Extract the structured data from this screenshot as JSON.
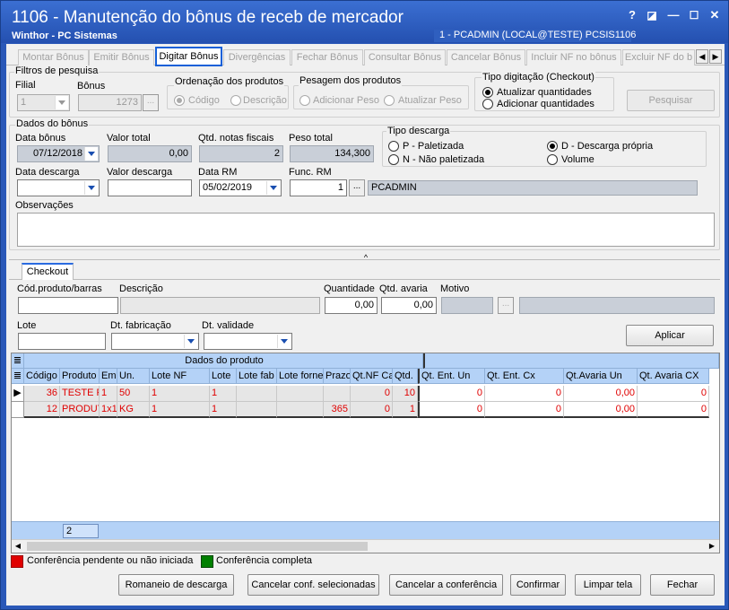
{
  "window": {
    "title": "1106 - Manutenção do bônus de receb de mercador",
    "subtitle": "Winthor - PC Sistemas",
    "user_info": "1 - PCADMIN (LOCAL@TESTE)   PCSIS1106",
    "controls": {
      "help": "?",
      "restore": "◪",
      "minimize": "—",
      "maximize": "☐",
      "close": "✕"
    }
  },
  "tabs": [
    {
      "label": "Montar Bônus",
      "active": false
    },
    {
      "label": "Emitir Bônus",
      "active": false
    },
    {
      "label": "Digitar Bônus",
      "active": true
    },
    {
      "label": "Divergências",
      "active": false
    },
    {
      "label": "Fechar Bônus",
      "active": false
    },
    {
      "label": "Consultar Bônus",
      "active": false
    },
    {
      "label": "Cancelar Bônus",
      "active": false
    },
    {
      "label": "Incluir NF no bônus",
      "active": false
    },
    {
      "label": "Excluir NF do b",
      "active": false
    }
  ],
  "tab_scroll": {
    "left": "◀",
    "right": "▶"
  },
  "filtros": {
    "legend": "Filtros de pesquisa",
    "filial_label": "Filial",
    "filial_value": "1",
    "bonus_label": "Bônus",
    "bonus_value": "1273",
    "ordenacao": {
      "legend": "Ordenação dos produtos",
      "options": [
        "Código",
        "Descrição"
      ],
      "selected": "Código"
    },
    "pesagem": {
      "legend": "Pesagem dos produtos",
      "options": [
        "Adicionar Peso",
        "Atualizar Peso"
      ]
    },
    "tipo_digitacao": {
      "legend": "Tipo digitação (Checkout)",
      "options": [
        "Atualizar quantidades",
        "Adicionar quantidades"
      ],
      "selected": "Atualizar quantidades"
    },
    "pesquisar_button": "Pesquisar"
  },
  "dados_bonus": {
    "legend": "Dados do bônus",
    "data_bonus_label": "Data bônus",
    "data_bonus_value": "07/12/2018",
    "valor_total_label": "Valor total",
    "valor_total_value": "0,00",
    "qtd_notas_label": "Qtd. notas fiscais",
    "qtd_notas_value": "2",
    "peso_total_label": "Peso total",
    "peso_total_value": "134,300",
    "tipo_descarga": {
      "legend": "Tipo descarga",
      "options": [
        "P - Paletizada",
        "N - Não paletizada",
        "D - Descarga própria",
        "Volume"
      ],
      "selected": "D - Descarga própria"
    },
    "data_descarga_label": "Data descarga",
    "data_descarga_value": "",
    "valor_descarga_label": "Valor descarga",
    "valor_descarga_value": "",
    "data_rm_label": "Data RM",
    "data_rm_value": "05/02/2019",
    "func_rm_label": "Func. RM",
    "func_rm_value": "1",
    "func_rm_name": "PCADMIN",
    "observacoes_label": "Observações",
    "observacoes_value": ""
  },
  "checkout": {
    "tab_label": "Checkout",
    "cod_produto_label": "Cód.produto/barras",
    "descricao_label": "Descrição",
    "quantidade_label": "Quantidade",
    "quantidade_value": "0,00",
    "qtd_avaria_label": "Qtd. avaria",
    "qtd_avaria_value": "0,00",
    "motivo_label": "Motivo",
    "lote_label": "Lote",
    "dt_fabricacao_label": "Dt. fabricação",
    "dt_validade_label": "Dt. validade",
    "aplicar_button": "Aplicar"
  },
  "grid": {
    "group_header": "Dados do produto",
    "columns": [
      "Código",
      "Produto",
      "Emb",
      "Un.",
      "Lote NF",
      "Lote",
      "Lote fab",
      "Lote forne",
      "Prazo",
      "Qt.NF Ca",
      "Qtd.",
      "Qt. Ent. Un",
      "Qt. Ent. Cx",
      "Qt.Avaria Un",
      "Qt. Avaria CX"
    ],
    "rows": [
      [
        "36",
        "TESTE F",
        "1",
        "50",
        "1",
        "1",
        "",
        "",
        "",
        "0",
        "10",
        "0",
        "0",
        "0,00",
        "0"
      ],
      [
        "12",
        "PRODUT",
        "1x1",
        "KG",
        "1",
        "1",
        "",
        "",
        "365",
        "0",
        "1",
        "0",
        "0",
        "0,00",
        "0"
      ]
    ],
    "footer_count": "2"
  },
  "legend": {
    "pending_color": "#e00000",
    "pending_label": "Conferência pendente ou não iniciada",
    "complete_color": "#008000",
    "complete_label": "Conferência completa"
  },
  "buttons": {
    "romaneio": "Romaneio de descarga",
    "cancelar_conf": "Cancelar conf. selecionadas",
    "cancelar_conferencia": "Cancelar a conferência",
    "confirmar": "Confirmar",
    "limpar": "Limpar tela",
    "fechar": "Fechar"
  }
}
